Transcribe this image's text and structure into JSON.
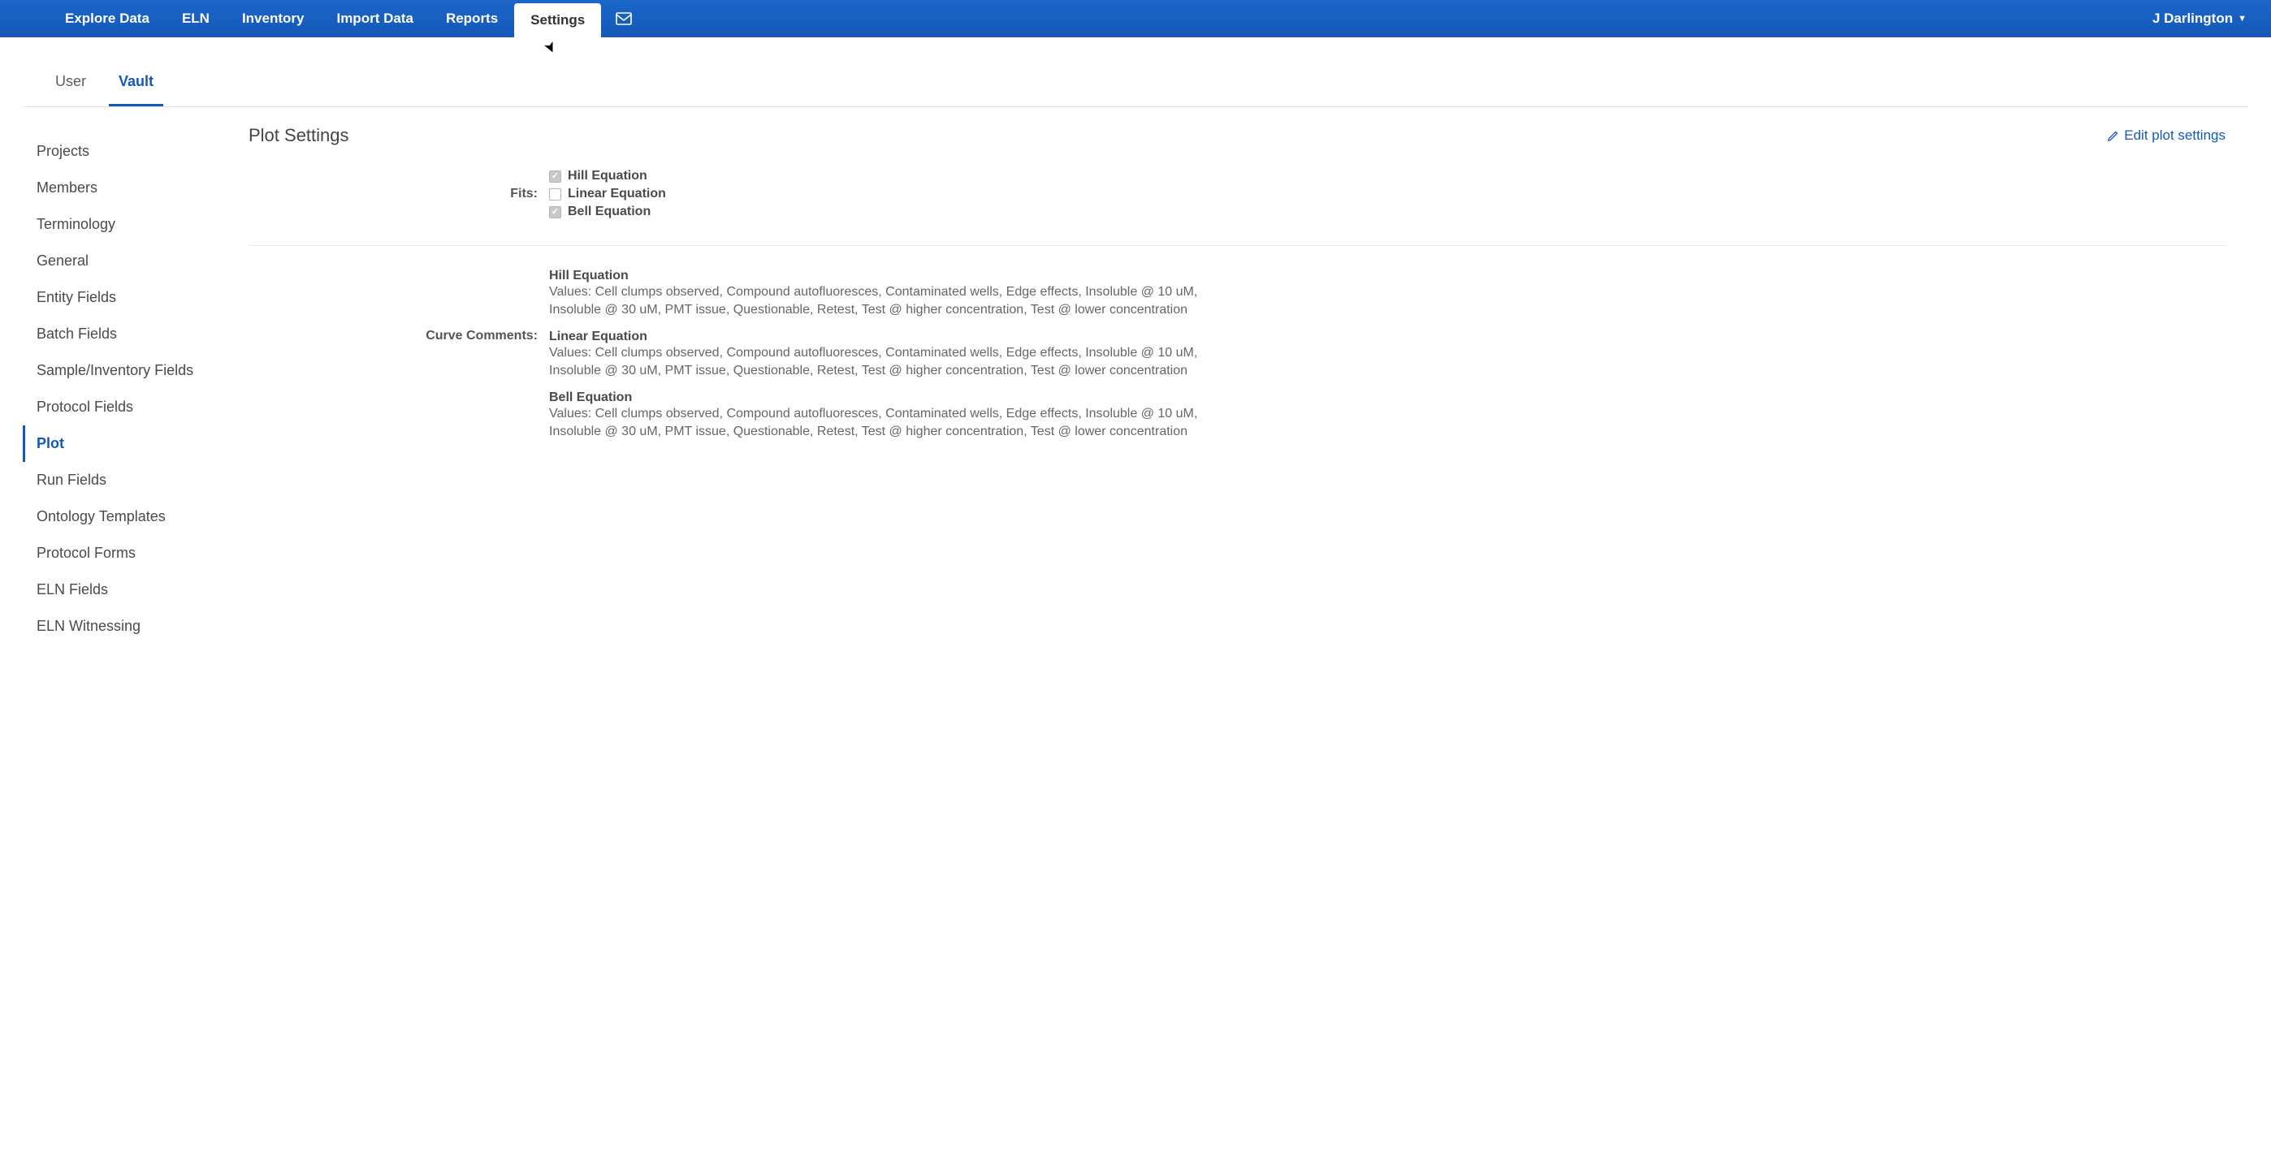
{
  "topnav": {
    "items": [
      {
        "label": "Explore Data"
      },
      {
        "label": "ELN"
      },
      {
        "label": "Inventory"
      },
      {
        "label": "Import Data"
      },
      {
        "label": "Reports"
      },
      {
        "label": "Settings",
        "active": true
      }
    ],
    "user": "J Darlington"
  },
  "subtabs": [
    {
      "label": "User"
    },
    {
      "label": "Vault",
      "active": true
    }
  ],
  "sidebar": [
    {
      "label": "Projects"
    },
    {
      "label": "Members"
    },
    {
      "label": "Terminology"
    },
    {
      "label": "General"
    },
    {
      "label": "Entity Fields"
    },
    {
      "label": "Batch Fields"
    },
    {
      "label": "Sample/Inventory Fields"
    },
    {
      "label": "Protocol Fields"
    },
    {
      "label": "Plot",
      "active": true
    },
    {
      "label": "Run Fields"
    },
    {
      "label": "Ontology Templates"
    },
    {
      "label": "Protocol Forms"
    },
    {
      "label": "ELN Fields"
    },
    {
      "label": "ELN Witnessing"
    }
  ],
  "content": {
    "title": "Plot Settings",
    "edit_label": "Edit plot settings",
    "fits_label": "Fits:",
    "fits": [
      {
        "label": "Hill Equation",
        "checked": true
      },
      {
        "label": "Linear Equation",
        "checked": false
      },
      {
        "label": "Bell Equation",
        "checked": true
      }
    ],
    "curve_comments_label": "Curve Comments:",
    "curve_comments": [
      {
        "title": "Hill Equation",
        "values": "Values: Cell clumps observed, Compound autofluoresces, Contaminated wells, Edge effects, Insoluble @ 10 uM, Insoluble @ 30 uM, PMT issue, Questionable, Retest, Test @ higher concentration, Test @ lower concentration"
      },
      {
        "title": "Linear Equation",
        "values": "Values: Cell clumps observed, Compound autofluoresces, Contaminated wells, Edge effects, Insoluble @ 10 uM, Insoluble @ 30 uM, PMT issue, Questionable, Retest, Test @ higher concentration, Test @ lower concentration"
      },
      {
        "title": "Bell Equation",
        "values": "Values: Cell clumps observed, Compound autofluoresces, Contaminated wells, Edge effects, Insoluble @ 10 uM, Insoluble @ 30 uM, PMT issue, Questionable, Retest, Test @ higher concentration, Test @ lower concentration"
      }
    ]
  }
}
